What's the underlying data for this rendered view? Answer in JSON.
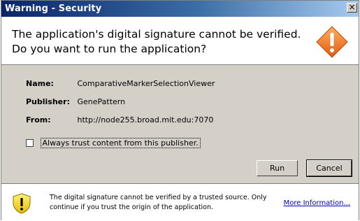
{
  "window": {
    "title": "Warning - Security",
    "close_glyph": "×"
  },
  "header": {
    "message_line1": "The application's digital signature cannot be verified.",
    "message_line2": "Do you want to run the application?",
    "icon": "warning-diamond-icon",
    "icon_color": "#f07020"
  },
  "details": {
    "name_label": "Name:",
    "name_value": "ComparativeMarkerSelectionViewer",
    "publisher_label": "Publisher:",
    "publisher_value": "GenePattern",
    "from_label": "From:",
    "from_value": "http://node255.broad.mit.edu:7070"
  },
  "checkbox": {
    "label": "Always trust content from this publisher.",
    "checked": false
  },
  "buttons": {
    "run": "Run",
    "cancel": "Cancel"
  },
  "footer": {
    "icon": "shield-warning-icon",
    "text": "The digital signature cannot be verified by a trusted source.  Only continue if you trust the origin of the application.",
    "link": "More Information..."
  },
  "colors": {
    "titlebar": "#0a246a",
    "dialog_bg": "#d4d0c8",
    "link": "#0000cc"
  }
}
